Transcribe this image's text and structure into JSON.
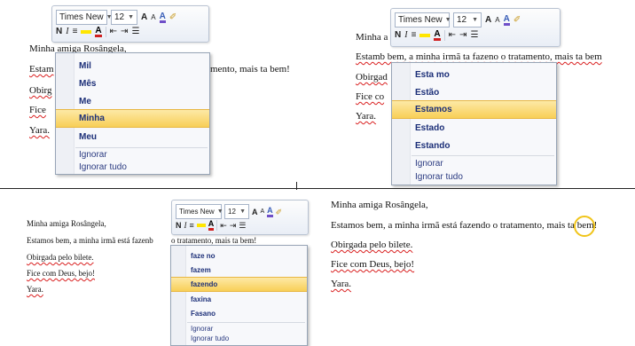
{
  "toolbar": {
    "font_name": "Times New",
    "font_size": "12",
    "grow_font": "A",
    "shrink_font": "A",
    "bold": "N",
    "italic": "I",
    "align": "≡",
    "decrease_indent": "⇤",
    "increase_indent": "⇥",
    "bullets": "☰",
    "highlight_color": "#ffe600",
    "font_color": "#d02020"
  },
  "panel_tl": {
    "lines": [
      "Minha amiga Rosângela,",
      "Estam",
      "mento, mais ta bem!",
      "Obirg",
      "Fice",
      "Yara."
    ],
    "menu": {
      "items": [
        "Mil",
        "Mês",
        "Me",
        "Minha",
        "Meu",
        "Ignorar",
        "Ignorar tudo"
      ],
      "selected": "Minha"
    }
  },
  "panel_tr": {
    "lines": [
      "Minha a",
      "Estamb bem, a minha irmã ta fazeno o tratamento, mais ta bem",
      "Obirgad",
      "Fice co",
      "Yara."
    ],
    "menu": {
      "items": [
        "Esta mo",
        "Estão",
        "Estamos",
        "Estado",
        "Estando",
        "Ignorar",
        "Ignorar tudo"
      ],
      "selected": "Estamos"
    }
  },
  "panel_bl": {
    "lines": [
      "Minha amiga Rosângela,",
      "Estamos bem, a minha irmã está fazenb",
      "o tratamento, mais ta bem!",
      "Obirgada pelo bilete.",
      "Fice com Deus, bejo!",
      "Yara."
    ],
    "menu": {
      "items": [
        "faze no",
        "fazem",
        "fazendo",
        "faxina",
        "Fasano",
        "Ignorar",
        "Ignorar tudo"
      ],
      "selected": "fazendo"
    }
  },
  "panel_br": {
    "lines": [
      "Minha amiga Rosângela,",
      "Estamos bem, a minha irmã está fazendo o tratamento, m",
      "ais",
      " ta bem!",
      "Obirgada pelo bilete.",
      "Fice com Deus, bejo!",
      "Yara."
    ]
  }
}
